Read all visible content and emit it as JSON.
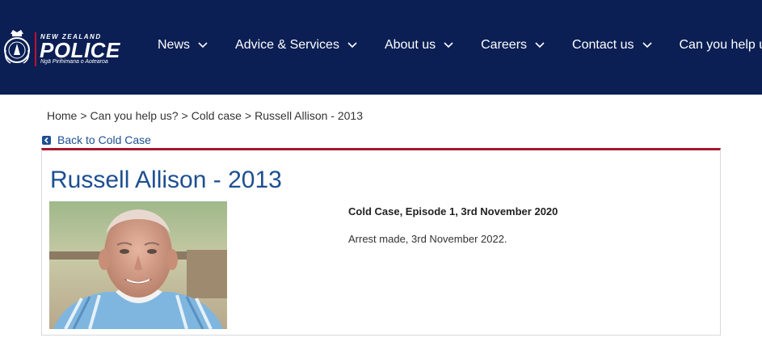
{
  "header": {
    "logo_top": "NEW ZEALAND",
    "logo_main": "POLICE",
    "logo_sub": "Ngā Pirihimana o Aotearoa",
    "logo_icon": "police-crest-icon",
    "background": "#0b1f54"
  },
  "nav": {
    "items": [
      {
        "label": "News"
      },
      {
        "label": "Advice & Services"
      },
      {
        "label": "About us"
      },
      {
        "label": "Careers"
      },
      {
        "label": "Contact us"
      },
      {
        "label": "Can you help us?"
      }
    ],
    "icon": "chevron-down-icon"
  },
  "breadcrumb": {
    "items": [
      "Home",
      "Can you help us?",
      "Cold case",
      "Russell Allison - 2013"
    ],
    "separator": ">"
  },
  "back_link": {
    "label": "Back to Cold Case",
    "icon": "back-arrow-icon"
  },
  "case": {
    "title": "Russell Allison - 2013",
    "episode": "Cold Case, Episode 1, 3rd November 2020",
    "status": "Arrest made, 3rd November 2022.",
    "accent": "#a6192e",
    "title_color": "#1d4f91"
  }
}
